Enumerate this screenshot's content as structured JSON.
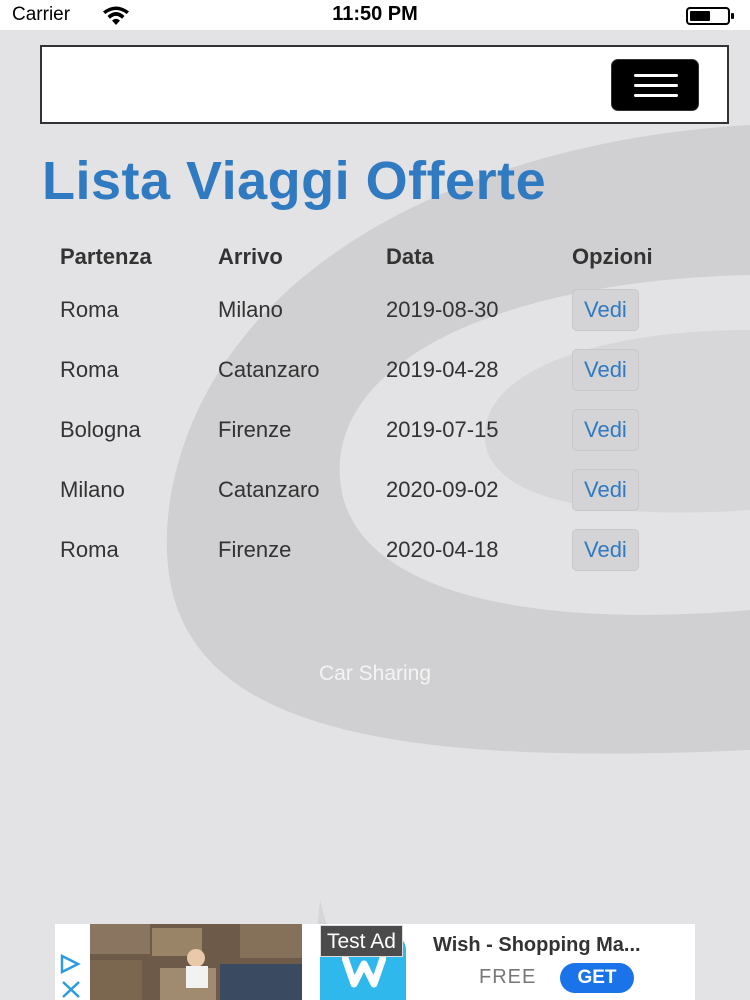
{
  "status_bar": {
    "carrier": "Carrier",
    "time": "11:50 PM",
    "icons": [
      "wifi-icon",
      "battery-icon"
    ]
  },
  "navbar": {
    "menu_icon": "hamburger-icon"
  },
  "page": {
    "title": "Lista Viaggi Offerte",
    "title_color": "#2f7ac0"
  },
  "table": {
    "headers": [
      "Partenza",
      "Arrivo",
      "Data",
      "Opzioni"
    ],
    "rows": [
      {
        "from": "Roma",
        "to": "Milano",
        "date": "2019-08-30",
        "action": "Vedi"
      },
      {
        "from": "Roma",
        "to": "Catanzaro",
        "date": "2019-04-28",
        "action": "Vedi"
      },
      {
        "from": "Bologna",
        "to": "Firenze",
        "date": "2019-07-15",
        "action": "Vedi"
      },
      {
        "from": "Milano",
        "to": "Catanzaro",
        "date": "2020-09-02",
        "action": "Vedi"
      },
      {
        "from": "Roma",
        "to": "Firenze",
        "date": "2020-04-18",
        "action": "Vedi"
      }
    ]
  },
  "footer": {
    "text": "Car Sharing"
  },
  "ad": {
    "badge": "Test Ad",
    "app_name": "Wish - Shopping Ma...",
    "price": "FREE",
    "cta": "GET",
    "cta_color": "#1a73e8",
    "icons": [
      "ad-choices-icon",
      "wish-app-icon"
    ]
  }
}
